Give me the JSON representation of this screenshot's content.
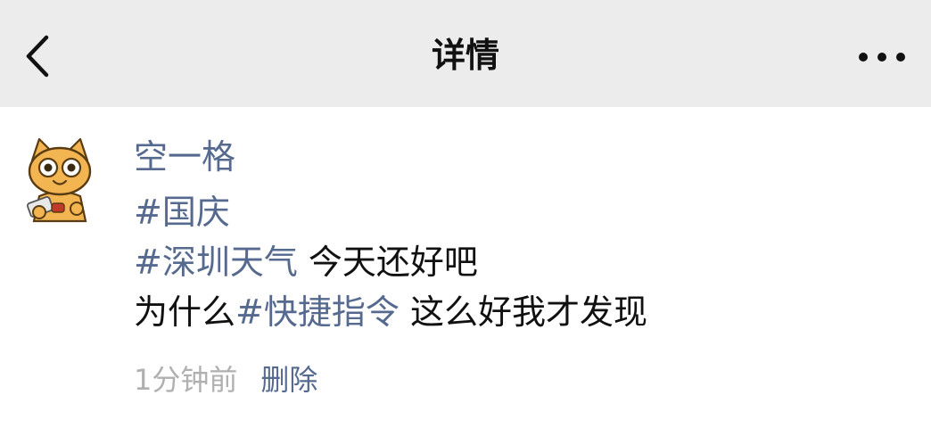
{
  "nav": {
    "title": "详情",
    "back_icon": "chevron-left-icon",
    "more_icon": "more-dots-icon"
  },
  "post": {
    "username": "空一格",
    "avatar": "cartoon-cat-avatar",
    "lines": [
      [
        {
          "text": "#国庆",
          "tag": true
        }
      ],
      [
        {
          "text": "#深圳天气",
          "tag": true
        },
        {
          "text": " 今天还好吧",
          "tag": false
        }
      ],
      [
        {
          "text": "为什么",
          "tag": false
        },
        {
          "text": "#快捷指令",
          "tag": true
        },
        {
          "text": " 这么好我才发现",
          "tag": false
        }
      ]
    ],
    "time": "1分钟前",
    "delete_label": "删除"
  },
  "colors": {
    "nav_bg": "#ececec",
    "link": "#56698f",
    "text": "#111111",
    "muted": "#b0b0b0"
  }
}
